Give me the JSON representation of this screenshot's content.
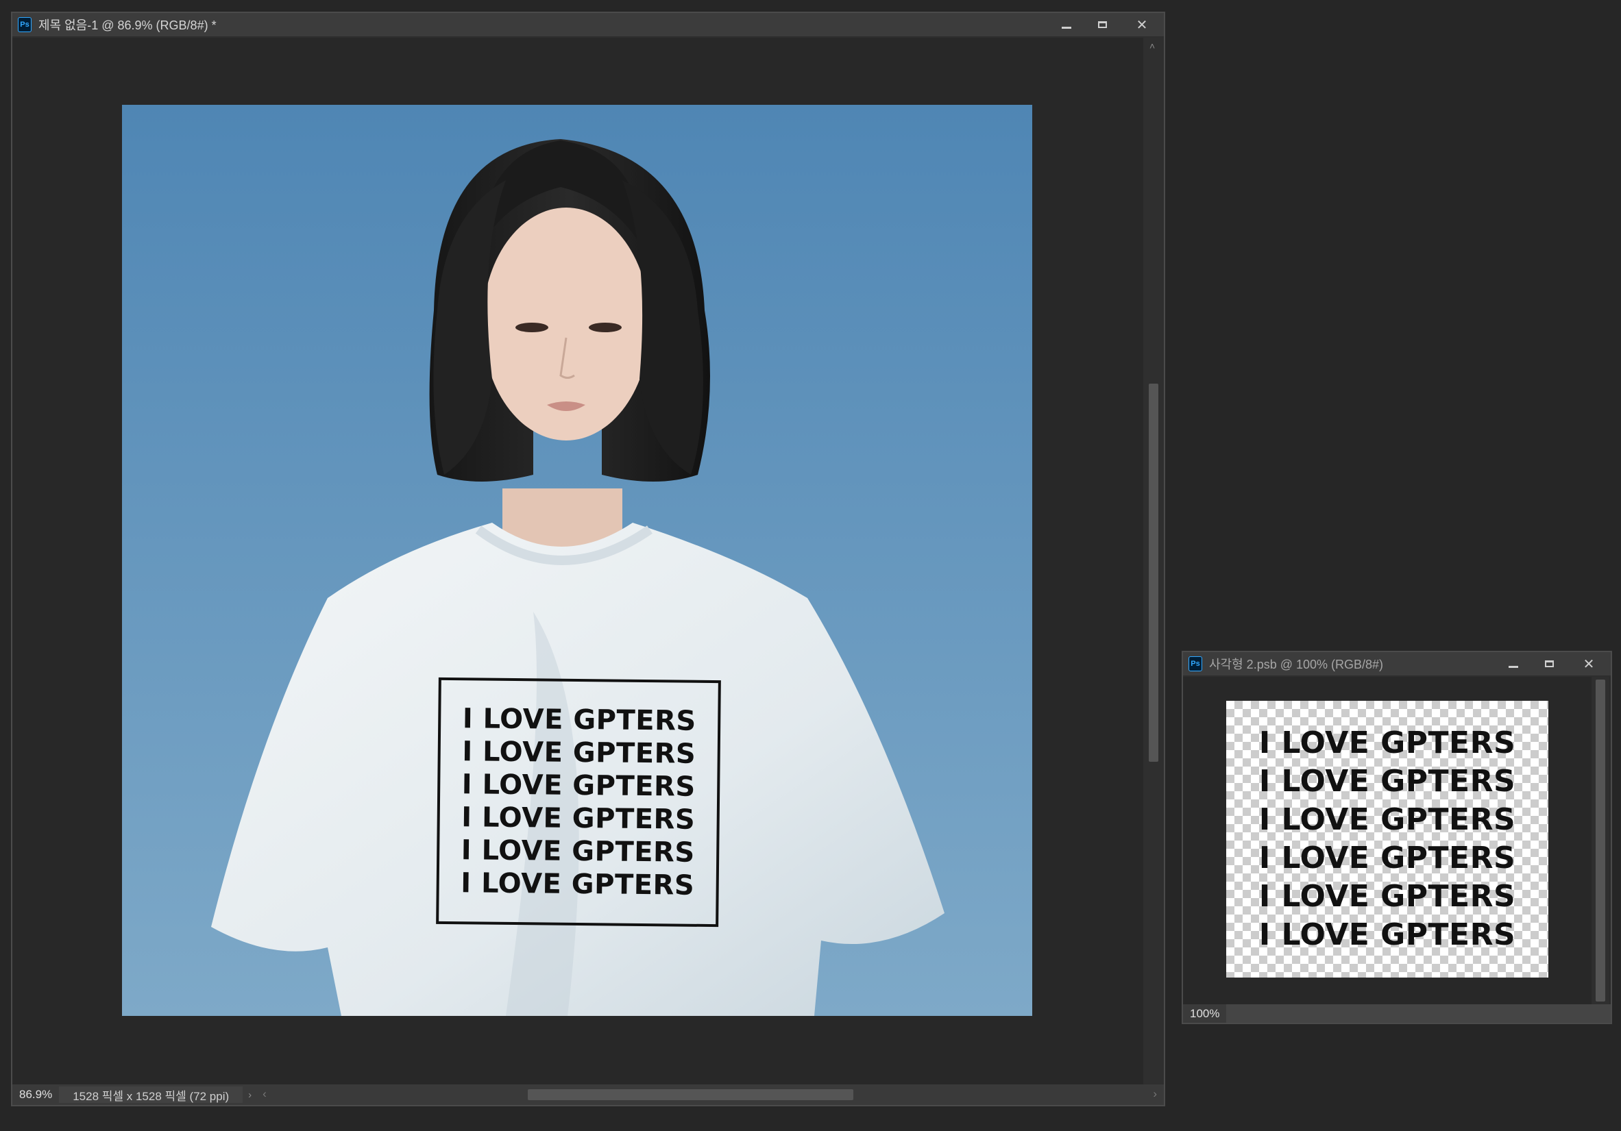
{
  "main_window": {
    "title": "제목 없음-1 @ 86.9% (RGB/8#) *",
    "app_icon": "Ps",
    "zoom": "86.9%",
    "doc_info": "1528 픽셀 x 1528 픽셀 (72 ppi)",
    "print_lines": [
      "I LOVE GPTERS",
      "I LOVE GPTERS",
      "I LOVE GPTERS",
      "I LOVE GPTERS",
      "I LOVE GPTERS",
      "I LOVE GPTERS"
    ]
  },
  "second_window": {
    "title": "사각형 2.psb @ 100% (RGB/8#)",
    "app_icon": "Ps",
    "zoom": "100%",
    "lines": [
      "I LOVE GPTERS",
      "I LOVE GPTERS",
      "I LOVE GPTERS",
      "I LOVE GPTERS",
      "I LOVE GPTERS",
      "I LOVE GPTERS"
    ]
  },
  "icons": {
    "minimize": "minimize-icon",
    "maximize": "maximize-icon",
    "close": "close-icon",
    "scroll_left": "chevron-left-icon",
    "scroll_right": "chevron-right-icon",
    "scroll_up": "chevron-up-icon",
    "scroll_down": "chevron-down-icon"
  },
  "colors": {
    "sky": "#5d8fb9",
    "shirt": "#e9eef0",
    "ps_blue": "#31a8ff"
  }
}
